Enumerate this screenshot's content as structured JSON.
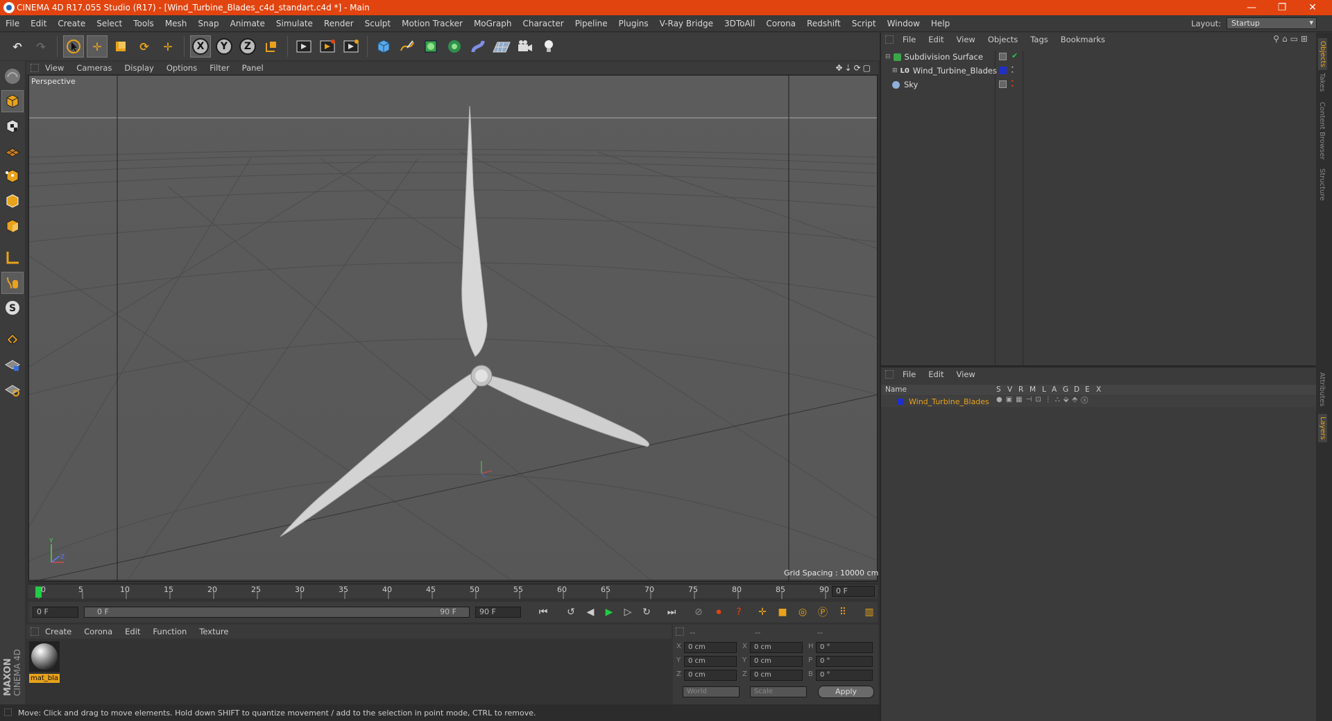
{
  "window": {
    "title": "CINEMA 4D R17.055 Studio (R17) - [Wind_Turbine_Blades_c4d_standart.c4d *] - Main",
    "minimize": "—",
    "restore": "❐",
    "close": "✕"
  },
  "menubar": {
    "items": [
      "File",
      "Edit",
      "Create",
      "Select",
      "Tools",
      "Mesh",
      "Snap",
      "Animate",
      "Simulate",
      "Render",
      "Sculpt",
      "Motion Tracker",
      "MoGraph",
      "Character",
      "Pipeline",
      "Plugins",
      "V-Ray Bridge",
      "3DToAll",
      "Corona",
      "Redshift",
      "Script",
      "Window",
      "Help"
    ],
    "layout_label": "Layout:",
    "layout_value": "Startup"
  },
  "toolbar": {
    "axis_x": "X",
    "axis_y": "Y",
    "axis_z": "Z"
  },
  "viewport": {
    "menu": [
      "View",
      "Cameras",
      "Display",
      "Options",
      "Filter",
      "Panel"
    ],
    "label": "Perspective",
    "grid_spacing": "Grid Spacing : 10000 cm"
  },
  "timeline": {
    "ticks": [
      "0",
      "5",
      "10",
      "15",
      "20",
      "25",
      "30",
      "35",
      "40",
      "45",
      "50",
      "55",
      "60",
      "65",
      "70",
      "75",
      "80",
      "85",
      "90"
    ],
    "current_frame": "0 F",
    "start_field": "0 F",
    "range_start": "0 F",
    "range_end": "90 F",
    "end_field": "90 F"
  },
  "material_manager": {
    "menu": [
      "Create",
      "Corona",
      "Edit",
      "Function",
      "Texture"
    ],
    "material_name": "mat_bla"
  },
  "coords": {
    "header": [
      "--",
      "--",
      "--"
    ],
    "rows": [
      {
        "a": "X",
        "av": "0 cm",
        "b": "X",
        "bv": "0 cm",
        "c": "H",
        "cv": "0 °"
      },
      {
        "a": "Y",
        "av": "0 cm",
        "b": "Y",
        "bv": "0 cm",
        "c": "P",
        "cv": "0 °"
      },
      {
        "a": "Z",
        "av": "0 cm",
        "b": "Z",
        "bv": "0 cm",
        "c": "B",
        "cv": "0 °"
      }
    ],
    "world": "World",
    "scale": "Scale",
    "apply": "Apply"
  },
  "objects_panel": {
    "menu": [
      "File",
      "Edit",
      "View",
      "Objects",
      "Tags",
      "Bookmarks"
    ],
    "items": [
      "Subdivision Surface",
      "Wind_Turbine_Blades",
      "Sky"
    ]
  },
  "layers_panel": {
    "menu": [
      "File",
      "Edit",
      "View"
    ],
    "header_name": "Name",
    "header_cols": [
      "S",
      "V",
      "R",
      "M",
      "L",
      "A",
      "G",
      "D",
      "E",
      "X"
    ],
    "layer_name": "Wind_Turbine_Blades"
  },
  "right_tabs": [
    "Objects",
    "Takes",
    "Content Browser",
    "Structure",
    "Attributes",
    "Layers"
  ],
  "brand": {
    "maxon": "MAXON",
    "cinema": "CINEMA 4D"
  },
  "status": "Move: Click and drag to move elements. Hold down SHIFT to quantize movement / add to the selection in point mode, CTRL to remove.",
  "colors": {
    "title_bar": "#e2440f",
    "accent_orange": "#e8a21c",
    "layer_blue": "#1f2fcc"
  }
}
